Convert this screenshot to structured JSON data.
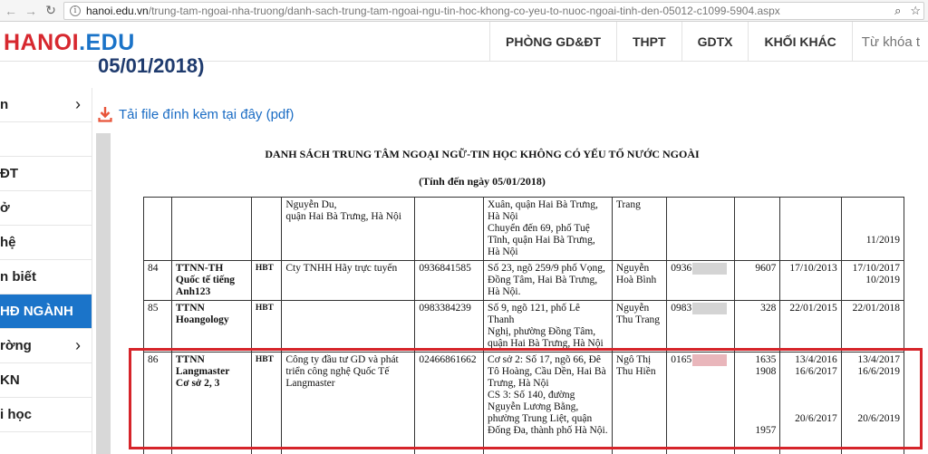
{
  "browser": {
    "url_host": "hanoi.edu.vn",
    "url_path": "/trung-tam-ngoai-nha-truong/danh-sach-trung-tam-ngoai-ngu-tin-hoc-khong-co-yeu-to-nuoc-ngoai-tinh-den-05012-c1099-5904.aspx"
  },
  "logo": {
    "part1": "HANOI",
    "part2": ".EDU"
  },
  "top_nav": [
    "PHÒNG GD&ĐT",
    "THPT",
    "GDTX",
    "KHỐI KHÁC"
  ],
  "search": {
    "placeholder": "Từ khóa t"
  },
  "page_title_tail": "05/01/2018)",
  "sidebar": [
    {
      "label": "n",
      "chevron": true,
      "active": false
    },
    {
      "label": "",
      "chevron": false,
      "active": false
    },
    {
      "label": "ĐT",
      "chevron": false,
      "active": false
    },
    {
      "label": "ở",
      "chevron": false,
      "active": false
    },
    {
      "label": "hệ",
      "chevron": false,
      "active": false
    },
    {
      "label": "n biết",
      "chevron": false,
      "active": false
    },
    {
      "label": "HĐ NGÀNH",
      "chevron": false,
      "active": true
    },
    {
      "label": "rờng",
      "chevron": true,
      "active": false
    },
    {
      "label": "KN",
      "chevron": false,
      "active": false
    },
    {
      "label": "i học",
      "chevron": false,
      "active": false
    }
  ],
  "attachment": {
    "label": "Tải file đính kèm tại đây (pdf)"
  },
  "document": {
    "title": "DANH SÁCH TRUNG TÂM NGOẠI NGỮ-TIN HỌC KHÔNG CÓ YẾU TỐ NƯỚC NGOÀI",
    "subtitle": "(Tính đến ngày 05/01/2018)",
    "rows": [
      {
        "stt": "",
        "name": "",
        "district": "",
        "owner": "Nguyễn Du,\nquận Hai Bà Trưng, Hà Nội",
        "phone": "",
        "address": "Xuân, quận Hai Bà Trưng,\nHà Nội\nChuyển đến 69, phố Tuệ\nTĩnh, quận Hai Bà Trưng,\nHà Nội",
        "director": "Trang",
        "director_phone": "",
        "decision": "",
        "date": "",
        "expiry": "\n\n\n11/2019"
      },
      {
        "stt": "84",
        "name": "TTNN-TH\nQuốc tế tiếng\nAnh123",
        "district": "HBT",
        "owner": "Cty TNHH Hãy trực tuyến",
        "phone": "0936841585",
        "address": "Số 23, ngõ 259/9 phố Vọng,\nĐồng Tâm, Hai Bà Trưng,\nHà Nội.",
        "director": "Nguyễn\nHoà Bình",
        "director_phone": "0936",
        "decision": "9607",
        "date": "17/10/2013",
        "expiry": "17/10/2017\n10/2019"
      },
      {
        "stt": "85",
        "name": "TTNN\nHoangology",
        "district": "HBT",
        "owner": "",
        "phone": "0983384239",
        "address": "Số 9, ngõ 121, phố Lê Thanh\nNghị, phường Đồng Tâm,\nquận Hai Bà Trưng, Hà Nội",
        "director": "Nguyễn\nThu Trang",
        "director_phone": "0983",
        "decision": "328",
        "date": "22/01/2015",
        "expiry": "22/01/2018"
      },
      {
        "stt": "86",
        "name": "TTNN\nLangmaster\nCơ sở 2, 3",
        "district": "HBT",
        "owner": "Công ty đầu tư GD và phát\ntriển công nghệ Quốc Tế\nLangmaster",
        "phone": "02466861662",
        "address": "Cơ sở 2: Số 17, ngõ 66, Đê\nTô Hoàng, Cầu Dền, Hai Bà\nTrưng, Hà Nội\nCS 3: Số 140, đường\nNguyễn Lương Bằng,\nphường Trung Liệt, quận\nĐống Đa, thành phố Hà Nội.",
        "director": "Ngô Thị\nThu Hiền",
        "director_phone": "0165",
        "decision": "1635\n1908\n\n\n\n\n1957",
        "date": "13/4/2016\n16/6/2017\n\n\n\n20/6/2017",
        "expiry": "13/4/2017\n16/6/2019\n\n\n\n20/6/2019"
      }
    ]
  }
}
